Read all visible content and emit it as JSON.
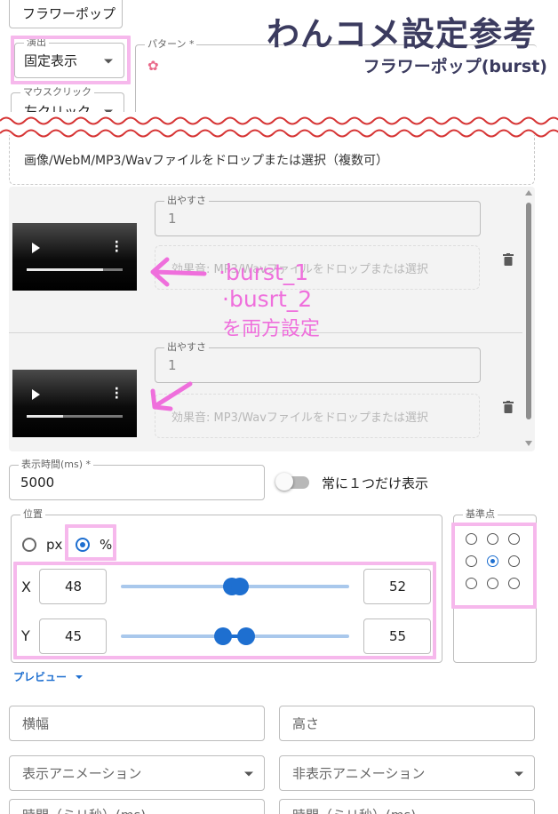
{
  "banner": {
    "title": "わんコメ設定参考",
    "subtitle": "フラワーポップ(burst)"
  },
  "top": {
    "effect_select_value": "フラワーポップ",
    "direction_label": "演出",
    "direction_value": "固定表示",
    "pattern_label": "パターン *",
    "pattern_icon": "flower-icon",
    "mouse_click_label": "マウスクリック",
    "mouse_click_value": "左クリック"
  },
  "file_drop": {
    "text": "画像/WebM/MP3/Wavファイルをドロップまたは選択（複数可）"
  },
  "effects": [
    {
      "ease_label": "出やすさ",
      "ease_value": "1",
      "sound_drop_text": "効果音: MP3/Wavファイルをドロップまたは選択",
      "video_progress": 0.8
    },
    {
      "ease_label": "出やすさ",
      "ease_value": "1",
      "sound_drop_text": "効果音: MP3/Wavファイルをドロップまたは選択",
      "video_progress": 0.38
    }
  ],
  "annotation": {
    "line1": "·burst_1",
    "line2": "·busrt_2",
    "line3": "を両方設定"
  },
  "display_time": {
    "label": "表示時間(ms) *",
    "value": "5000"
  },
  "single_display": {
    "label": "常に１つだけ表示",
    "on": false
  },
  "position": {
    "label": "位置",
    "unit_px": "px",
    "unit_percent": "%",
    "selected_unit": "%",
    "x_label": "X",
    "x_min": "48",
    "x_max": "52",
    "y_label": "Y",
    "y_min": "45",
    "y_max": "55"
  },
  "anchor": {
    "label": "基準点",
    "selected": "center"
  },
  "preview_label": "プレビュー",
  "size": {
    "width_placeholder": "横幅",
    "height_placeholder": "高さ"
  },
  "animation": {
    "show_placeholder": "表示アニメーション",
    "hide_placeholder": "非表示アニメーション"
  },
  "duration": {
    "show_placeholder": "時間（ミリ秒）(ms)",
    "hide_placeholder": "時間（ミリ秒）(ms)"
  },
  "colors": {
    "accent": "#1e6fd0",
    "highlight": "#f6b8ec",
    "annotation": "#ef6fdc",
    "title": "#3b3b5f"
  }
}
